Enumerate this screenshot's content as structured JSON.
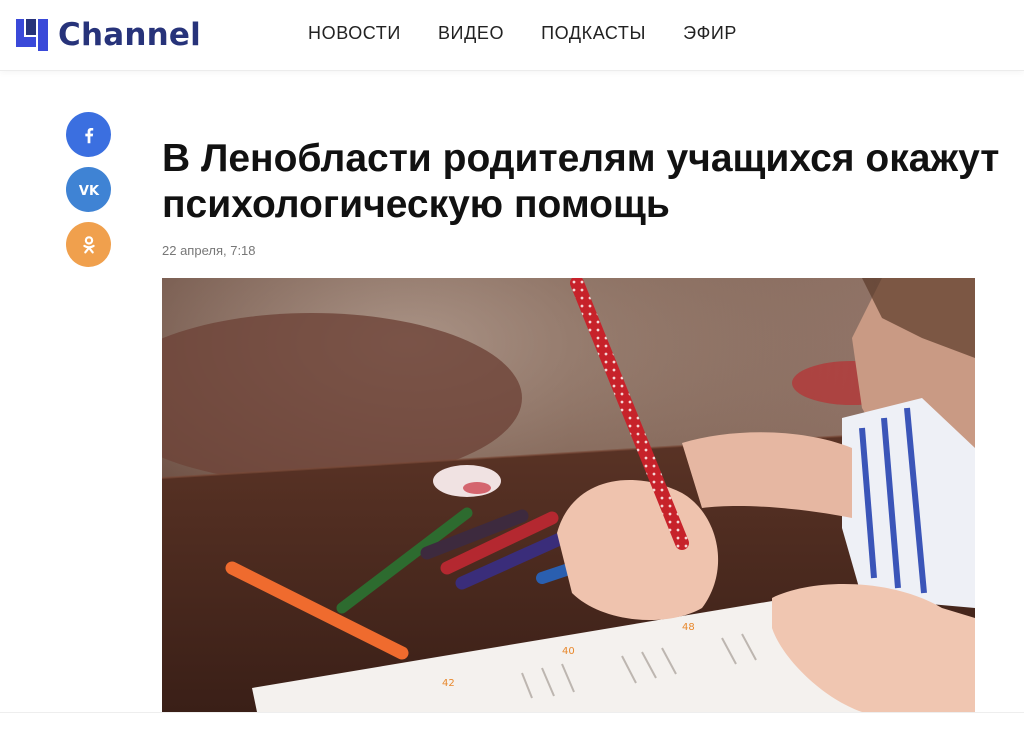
{
  "brand": {
    "logo_text": "Channel",
    "accent": "#3a49d9",
    "text_color": "#27337a"
  },
  "nav": {
    "items": [
      "НОВОСТИ",
      "ВИДЕО",
      "ПОДКАСТЫ",
      "ЭФИР"
    ]
  },
  "social": [
    {
      "name": "facebook-icon",
      "color": "#3b6fe0"
    },
    {
      "name": "vk-icon",
      "color": "#3f83d4"
    },
    {
      "name": "odnoklassniki-icon",
      "color": "#f0a04d"
    }
  ],
  "article": {
    "title": "В Ленобласти родителям учащихся окажут психологическую помощь",
    "date": "22 апреля, 7:18",
    "image_alt": "Ребёнок рисует карандашом за столом"
  }
}
